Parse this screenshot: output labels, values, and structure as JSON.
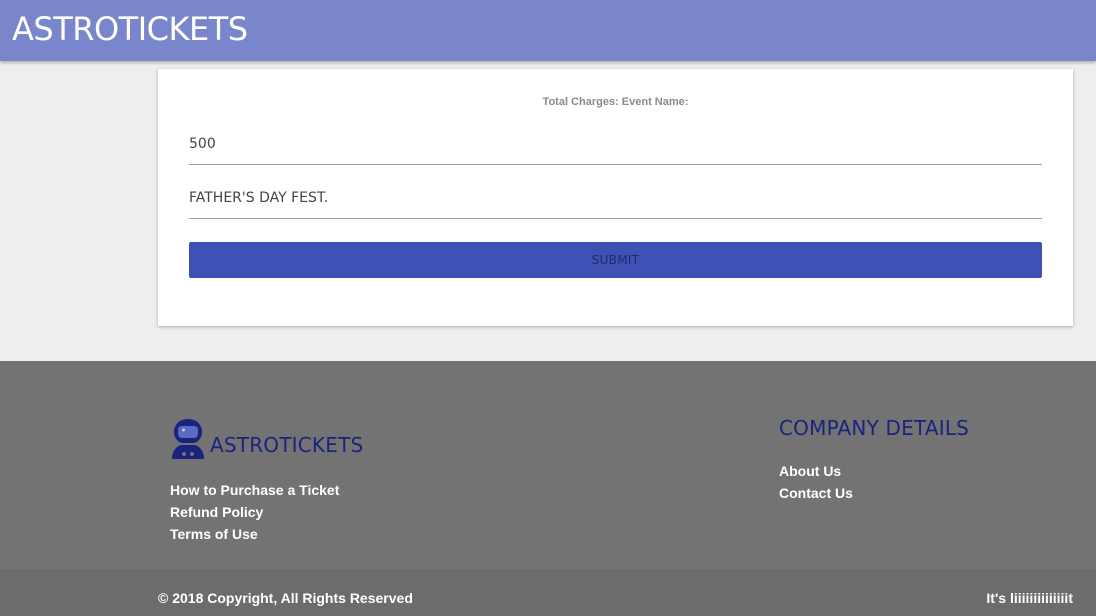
{
  "header": {
    "brand": "ASTROTICKETS"
  },
  "form": {
    "header": "Total Charges: Event Name:",
    "amount_value": "500",
    "event_value": "FATHER'S DAY FEST.",
    "submit_label": "SUBMIT"
  },
  "footer": {
    "brand": "ASTROTICKETS",
    "logo_icon": "astronaut-icon",
    "links": [
      "How to Purchase a Ticket",
      "Refund Policy",
      "Terms of Use"
    ],
    "company_title": "COMPANY DETAILS",
    "company_links": [
      "About Us",
      "Contact Us"
    ],
    "copyright": "© 2018 Copyright, All Rights Reserved",
    "tagline": "It's liiiiiiiiiiiiiit"
  },
  "colors": {
    "header_bg": "#7986cb",
    "accent": "#3f51b5",
    "footer_bg": "#737373",
    "brand_dark": "#1a237e"
  }
}
